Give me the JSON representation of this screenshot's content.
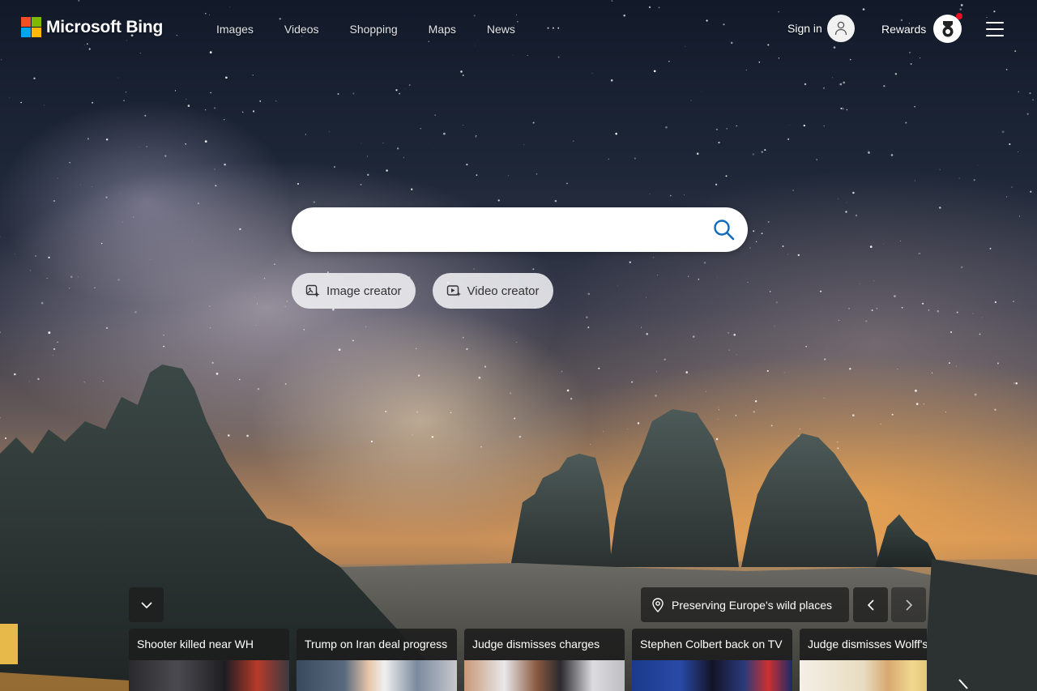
{
  "brand": {
    "name": "Microsoft Bing"
  },
  "nav": {
    "items": [
      "Images",
      "Videos",
      "Shopping",
      "Maps",
      "News"
    ],
    "more": "···"
  },
  "account": {
    "signin_label": "Sign in",
    "rewards_label": "Rewards"
  },
  "search": {
    "value": "",
    "placeholder": ""
  },
  "creators": {
    "image_label": "Image creator",
    "video_label": "Video creator"
  },
  "background": {
    "location_label": "Preserving Europe's wild places"
  },
  "news": [
    {
      "title": "Shooter killed near WH"
    },
    {
      "title": "Trump on Iran deal progress"
    },
    {
      "title": "Judge dismisses charges"
    },
    {
      "title": "Stephen Colbert back on TV"
    },
    {
      "title": "Judge dismisses Wolff's"
    }
  ],
  "colors": {
    "ms_red": "#f25022",
    "ms_green": "#7fba00",
    "ms_blue": "#00a4ef",
    "ms_yellow": "#ffb900",
    "search_icon": "#0f6cbd",
    "notification_dot": "#e81123"
  },
  "icons": {
    "search": "search-icon",
    "avatar": "user-avatar-icon",
    "rewards": "rewards-medal-icon",
    "menu": "hamburger-menu-icon",
    "image_creator": "image-sparkle-icon",
    "video_creator": "video-sparkle-icon",
    "location": "location-pin-icon",
    "collapse": "chevron-down-icon",
    "prev": "chevron-left-icon",
    "next": "chevron-right-icon"
  }
}
